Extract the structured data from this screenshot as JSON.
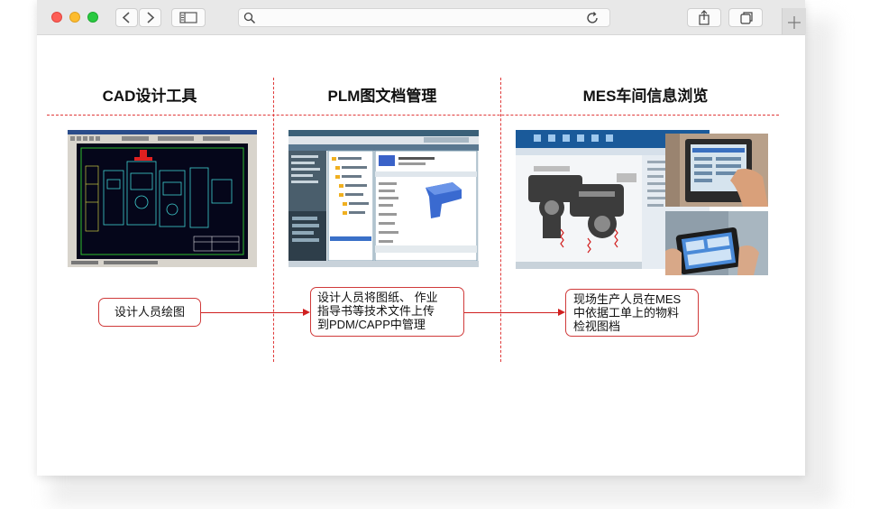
{
  "browser": {
    "traffic_lights": {
      "close": "#fd5f57",
      "minimize": "#fdbc2e",
      "zoom": "#29c940"
    },
    "buttons": {
      "back": "back",
      "forward": "forward",
      "sidebar": "sidebar",
      "reload": "reload",
      "share": "share",
      "tabs": "tabs",
      "new_tab": "new-tab"
    }
  },
  "page": {
    "columns": [
      {
        "title": "CAD设计工具"
      },
      {
        "title": "PLM图文档管理"
      },
      {
        "title": "MES车间信息浏览"
      }
    ],
    "notes": {
      "cad": "设计人员绘图",
      "plm_lines": [
        "设计人员将图纸、 作业",
        "指导书等技术文件上传",
        "到PDM/CAPP中管理"
      ],
      "mes_lines": [
        "现场生产人员在MES",
        "中依据工单上的物料",
        "检视图档"
      ]
    },
    "accent_color": "#e03a3a"
  }
}
